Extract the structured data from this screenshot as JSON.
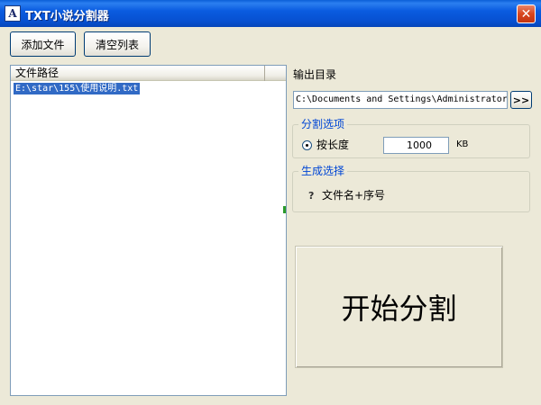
{
  "window": {
    "title": "TXT小说分割器",
    "icon_letter": "A",
    "close_glyph": "✕"
  },
  "toolbar": {
    "add_label": "添加文件",
    "clear_label": "清空列表"
  },
  "file_list": {
    "column_header": "文件路径",
    "items": [
      "E:\\star\\155\\使用说明.txt"
    ],
    "selected_index": 0
  },
  "output": {
    "label": "输出目录",
    "path_value": "C:\\Documents and Settings\\Administrator\\桌面",
    "browse_label": ">>"
  },
  "split_options": {
    "title": "分割选项",
    "by_length_label": "按长度",
    "by_length_selected": true,
    "size_value": "1000",
    "unit": "KB"
  },
  "generate": {
    "title": "生成选择",
    "option_label": "文件名+序号",
    "option_glyph": "?"
  },
  "start": {
    "label": "开始分割"
  },
  "colors": {
    "titlebar": "#0a5ce0",
    "window_bg": "#ece9d8",
    "selection": "#316ac5",
    "group_title": "#0046d5",
    "close_button": "#d8461e"
  }
}
